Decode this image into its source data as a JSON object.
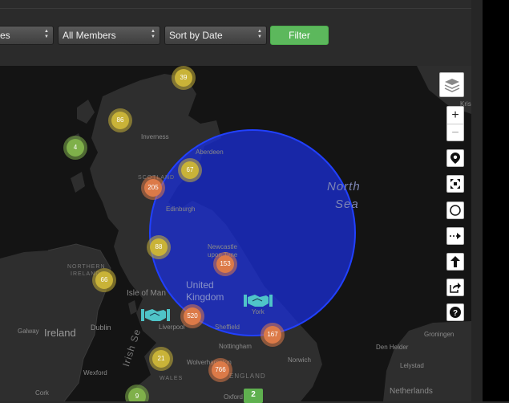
{
  "filters": {
    "first_select": "es",
    "members_select": "All Members",
    "sort_select": "Sort by Date",
    "filter_button": "Filter"
  },
  "map": {
    "labels": {
      "north_sea_1": "North",
      "north_sea_2": "Sea",
      "inverness": "Inverness",
      "aberdeen": "Aberdeen",
      "scotland": "SCOTLAND",
      "edinburgh": "Edinburgh",
      "newcastle_1": "Newcastle",
      "newcastle_2": "upon Tyne",
      "uk_1": "United",
      "uk_2": "Kingdom",
      "northern_ireland_1": "NORTHERN",
      "northern_ireland_2": "IRELAND",
      "isle_of_man": "Isle of Man",
      "galway": "Galway",
      "ireland": "Ireland",
      "dublin": "Dublin",
      "irish_sea": "Irish Se",
      "liverpool": "Liverpool",
      "sheffield": "Sheffield",
      "york": "York",
      "nottingham": "Nottingham",
      "wolverhampton": "Wolverhampton",
      "wales": "WALES",
      "england": "ENGLAND",
      "norwich": "Norwich",
      "wexford": "Wexford",
      "cork": "Cork",
      "oxford": "Oxford",
      "groningen": "Groningen",
      "den_helder": "Den Helder",
      "lelystad": "Lelystad",
      "netherlands": "Netherlands",
      "kris": "Kris"
    },
    "clusters": [
      {
        "name": "cluster-39",
        "count": "39",
        "color": "yellow"
      },
      {
        "name": "cluster-86",
        "count": "86",
        "color": "yellow"
      },
      {
        "name": "cluster-4",
        "count": "4",
        "color": "green"
      },
      {
        "name": "cluster-67",
        "count": "67",
        "color": "yellow"
      },
      {
        "name": "cluster-205",
        "count": "205",
        "color": "orange"
      },
      {
        "name": "cluster-88",
        "count": "88",
        "color": "yellow"
      },
      {
        "name": "cluster-153",
        "count": "153",
        "color": "orange"
      },
      {
        "name": "cluster-66",
        "count": "66",
        "color": "yellow"
      },
      {
        "name": "cluster-520",
        "count": "520",
        "color": "orange"
      },
      {
        "name": "cluster-167",
        "count": "167",
        "color": "orange"
      },
      {
        "name": "cluster-21",
        "count": "21",
        "color": "yellow"
      },
      {
        "name": "cluster-766",
        "count": "766",
        "color": "orange"
      },
      {
        "name": "cluster-9",
        "count": "9",
        "color": "green"
      }
    ],
    "pin_badge": "2",
    "circle_color": "#1a2fe0"
  },
  "controls": {
    "layers": "layers-icon",
    "zoom_in": "+",
    "zoom_out": "−",
    "tools": [
      "marker-icon",
      "fullscreen-icon",
      "circle-icon",
      "dashed-arrow-icon",
      "upload-icon",
      "share-icon",
      "help-icon"
    ]
  }
}
